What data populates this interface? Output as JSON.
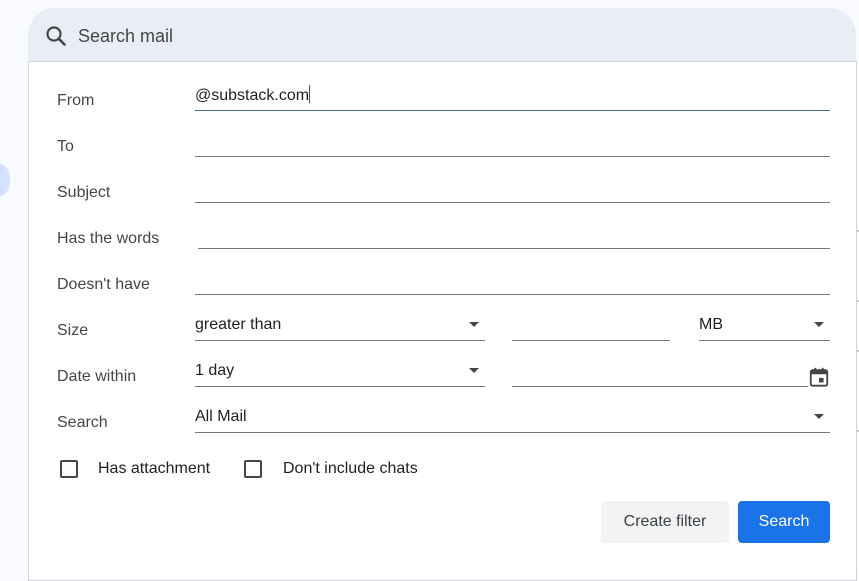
{
  "search": {
    "placeholder": "Search mail"
  },
  "form": {
    "from": {
      "label": "From",
      "value": "@substack.com"
    },
    "to": {
      "label": "To",
      "value": ""
    },
    "subject": {
      "label": "Subject",
      "value": ""
    },
    "has_words": {
      "label": "Has the words",
      "value": ""
    },
    "doesnt_have": {
      "label": "Doesn't have",
      "value": ""
    },
    "size": {
      "label": "Size",
      "operator": "greater than",
      "value": "",
      "unit": "MB"
    },
    "date_within": {
      "label": "Date within",
      "value": "1 day",
      "date": ""
    },
    "search_in": {
      "label": "Search",
      "value": "All Mail"
    },
    "has_attachment": {
      "label": "Has attachment",
      "checked": false
    },
    "dont_include_chats": {
      "label": "Don't include chats",
      "checked": false
    }
  },
  "buttons": {
    "create_filter": "Create filter",
    "search": "Search"
  },
  "colors": {
    "primary": "#1a73e8",
    "search_bar_bg": "#e9eef6",
    "secondary_button_bg": "#f1f3f4"
  }
}
